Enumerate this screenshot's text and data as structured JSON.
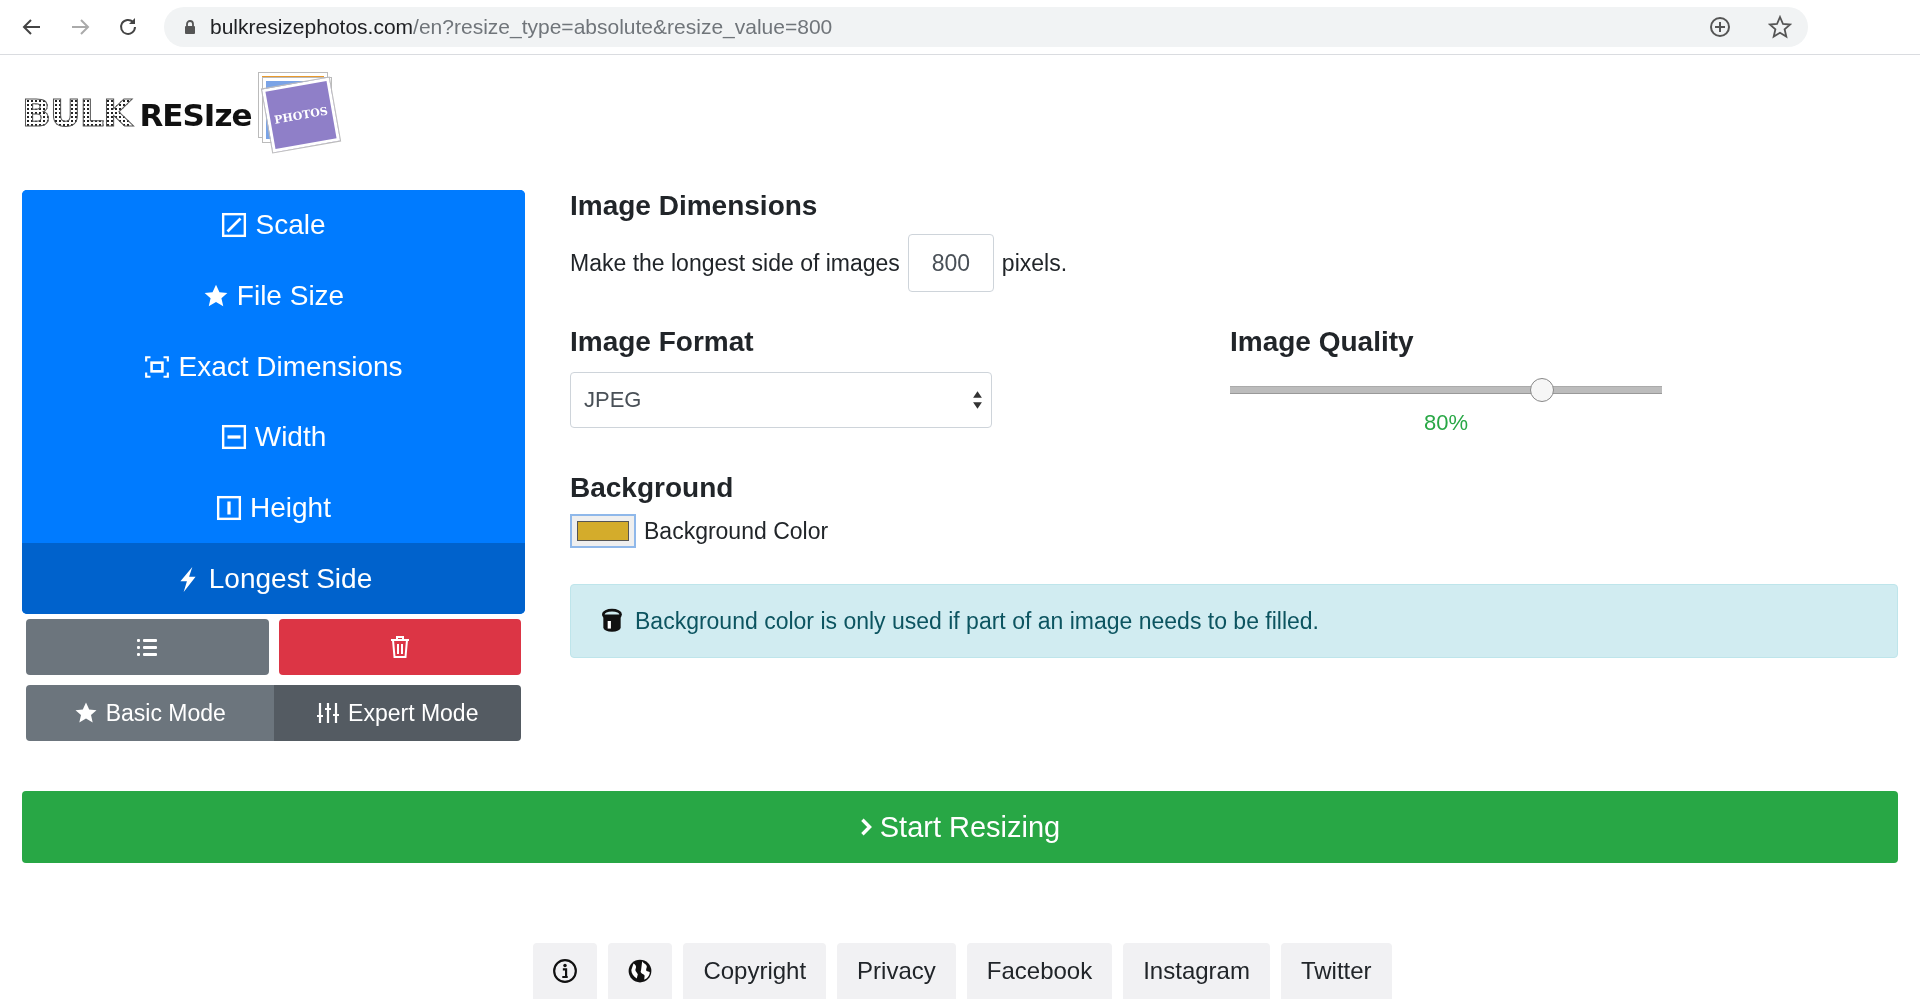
{
  "browser": {
    "url_host": "bulkresizephotos.com",
    "url_path": "/en?resize_type=absolute&resize_value=800"
  },
  "logo": {
    "word_1": "BULK",
    "word_2": "RESIze",
    "badge": "PHOTOS"
  },
  "modes": [
    {
      "label": "Scale",
      "kind": "scale",
      "selected": false
    },
    {
      "label": "File Size",
      "kind": "star",
      "selected": false
    },
    {
      "label": "Exact Dimensions",
      "kind": "dimensions",
      "selected": false
    },
    {
      "label": "Width",
      "kind": "width",
      "selected": false
    },
    {
      "label": "Height",
      "kind": "height",
      "selected": false
    },
    {
      "label": "Longest Side",
      "kind": "bolt",
      "selected": true
    }
  ],
  "mode_toggle": [
    {
      "label": "Basic Mode",
      "kind": "star",
      "selected": false
    },
    {
      "label": "Expert Mode",
      "kind": "sliders",
      "selected": true
    }
  ],
  "dimensions": {
    "heading": "Image Dimensions",
    "prefix": "Make the longest side of images",
    "value": "800",
    "suffix": "pixels."
  },
  "format": {
    "heading": "Image Format",
    "value": "JPEG"
  },
  "quality": {
    "heading": "Image Quality",
    "level": 0.72,
    "reading": "80%"
  },
  "background": {
    "heading": "Background",
    "color": "#d4ac2b",
    "label": "Background Color"
  },
  "alert": "Background color is only used if part of an image needs to be filled.",
  "start_button": "Start Resizing",
  "footer": [
    {
      "kind": "info"
    },
    {
      "kind": "globe"
    },
    {
      "kind": "link",
      "label": "Copyright"
    },
    {
      "kind": "link",
      "label": "Privacy"
    },
    {
      "kind": "link",
      "label": "Facebook"
    },
    {
      "kind": "link",
      "label": "Instagram"
    },
    {
      "kind": "link",
      "label": "Twitter"
    }
  ]
}
